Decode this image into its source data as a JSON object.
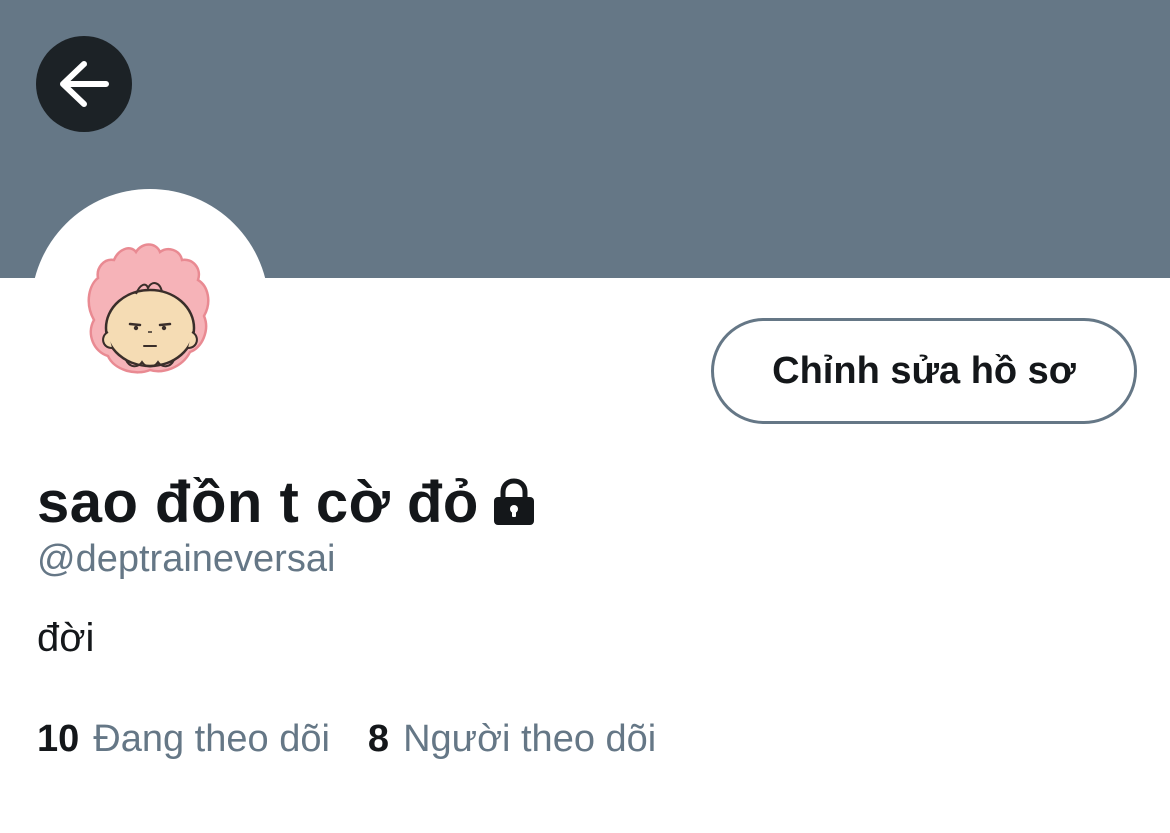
{
  "header": {
    "back_icon": "arrow-left-icon",
    "banner_color": "#657786"
  },
  "profile": {
    "avatar_icon": "cartoon-avatar-icon",
    "edit_button_label": "Chỉnh sửa hồ sơ",
    "display_name": "sao đồn t cờ đỏ",
    "lock_icon": "lock-icon",
    "handle": "@deptraineversai",
    "bio": "đời"
  },
  "stats": {
    "following_count": "10",
    "following_label": "Đang theo dõi",
    "followers_count": "8",
    "followers_label": "Người theo dõi"
  },
  "colors": {
    "text_primary": "#14171a",
    "text_secondary": "#657786",
    "back_button_bg": "#1c2226"
  }
}
